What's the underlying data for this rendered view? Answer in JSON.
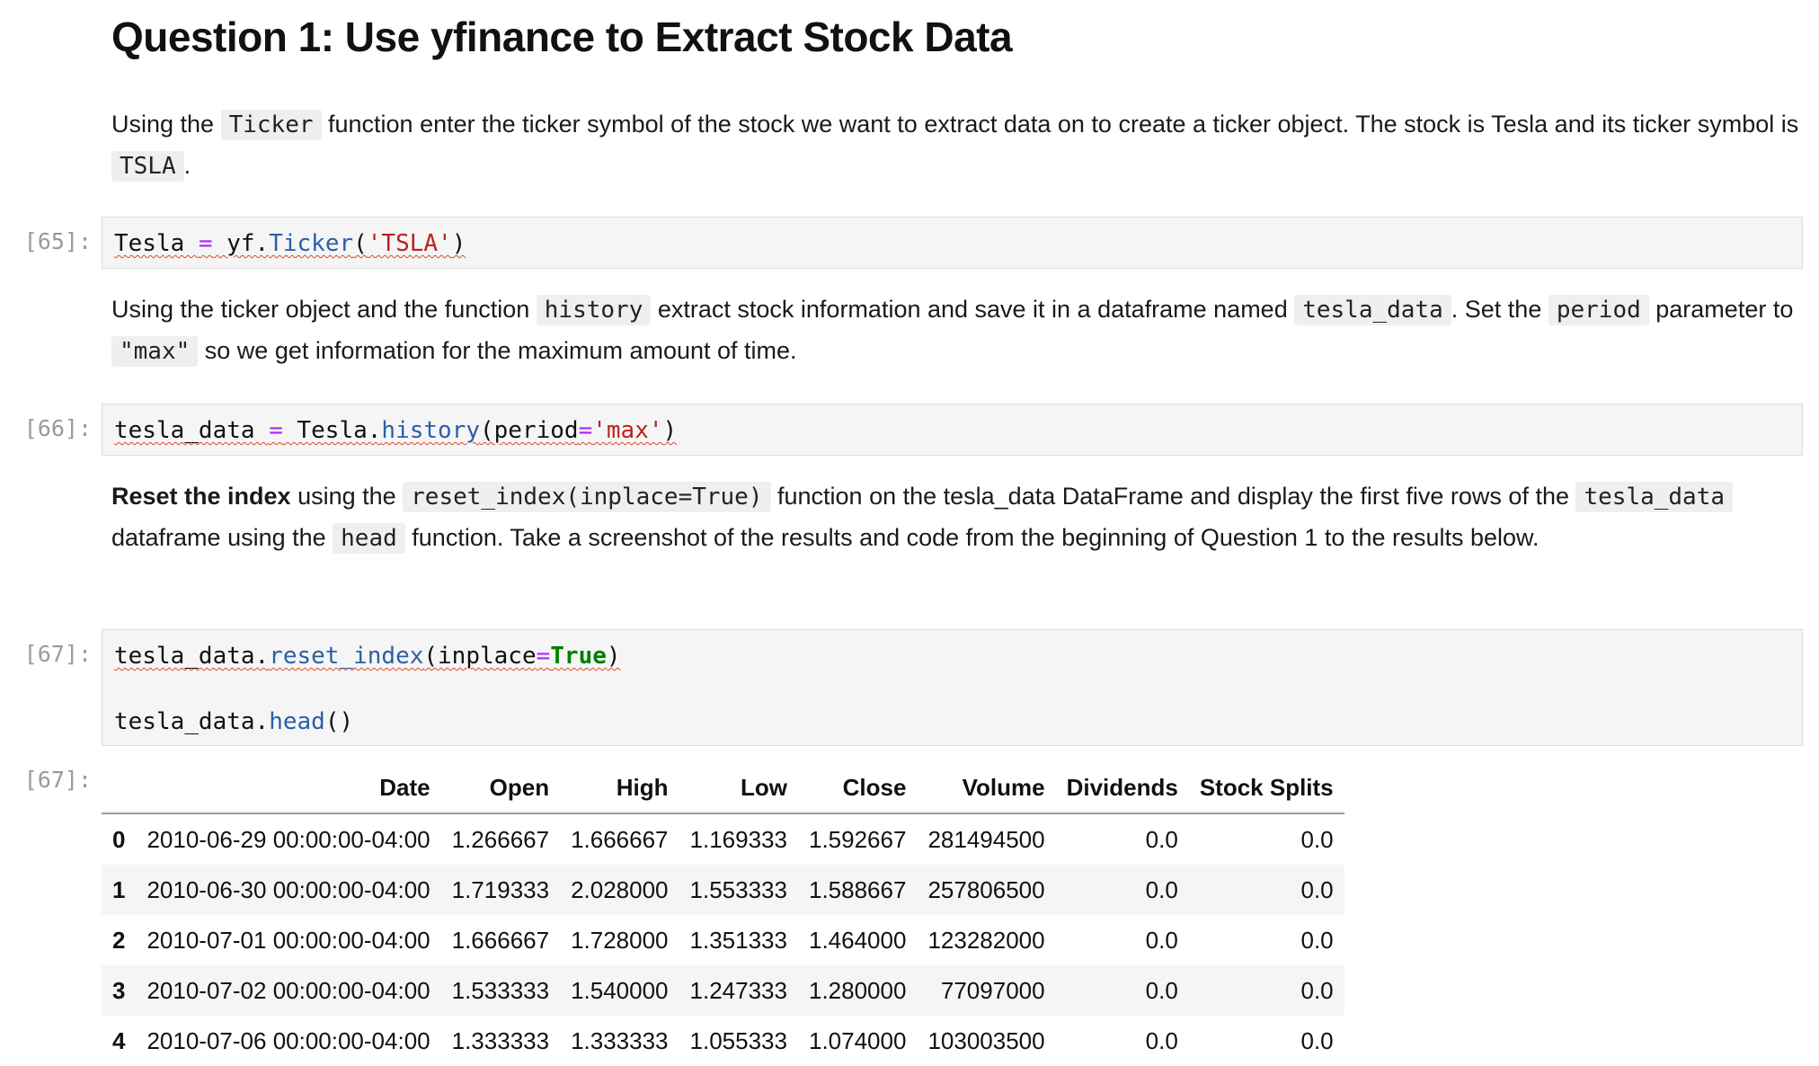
{
  "heading": "Question 1: Use yfinance to Extract Stock Data",
  "para1": {
    "t1": "Using the ",
    "c1": "Ticker",
    "t2": " function enter the ticker symbol of the stock we want to extract data on to create a ticker object. The stock is Tesla and its ticker symbol is ",
    "c2": "TSLA",
    "t3": "."
  },
  "cell65": {
    "prompt": "[65]:",
    "p1": "Tesla ",
    "p2": "=",
    "p3": " yf.",
    "p4": "Ticker",
    "p5": "(",
    "p6": "'TSLA'",
    "p7": ")"
  },
  "para2": {
    "t1": "Using the ticker object and the function ",
    "c1": "history",
    "t2": " extract stock information and save it in a dataframe named ",
    "c2": "tesla_data",
    "t3": ". Set the ",
    "c3": "period",
    "t4": " parameter to ",
    "c4": "\"max\"",
    "t5": " so we get information for the maximum amount of time."
  },
  "cell66": {
    "prompt": "[66]:",
    "p1": "tesla_data ",
    "p2": "=",
    "p3": " Tesla.",
    "p4": "history",
    "p5": "(period",
    "p6": "=",
    "p7": "'max'",
    "p8": ")"
  },
  "para3": {
    "b1": "Reset the index",
    "t1": " using the ",
    "c1": "reset_index(inplace=True)",
    "t2": " function on the tesla_data DataFrame and display the first five rows of the ",
    "c2": "tesla_data",
    "t3": " dataframe using the ",
    "c3": "head",
    "t4": " function. Take a screenshot of the results and code from the beginning of Question 1 to the results below."
  },
  "cell67": {
    "prompt": "[67]:",
    "l1p1": "tesla_data.",
    "l1p2": "reset_index",
    "l1p3": "(inplace",
    "l1p4": "=",
    "l1p5": "True",
    "l1p6": ")",
    "l2p1": "tesla_data.",
    "l2p2": "head",
    "l2p3": "()"
  },
  "output67": {
    "prompt": "[67]:",
    "columns": [
      "",
      "Date",
      "Open",
      "High",
      "Low",
      "Close",
      "Volume",
      "Dividends",
      "Stock Splits"
    ],
    "rows": [
      [
        "0",
        "2010-06-29 00:00:00-04:00",
        "1.266667",
        "1.666667",
        "1.169333",
        "1.592667",
        "281494500",
        "0.0",
        "0.0"
      ],
      [
        "1",
        "2010-06-30 00:00:00-04:00",
        "1.719333",
        "2.028000",
        "1.553333",
        "1.588667",
        "257806500",
        "0.0",
        "0.0"
      ],
      [
        "2",
        "2010-07-01 00:00:00-04:00",
        "1.666667",
        "1.728000",
        "1.351333",
        "1.464000",
        "123282000",
        "0.0",
        "0.0"
      ],
      [
        "3",
        "2010-07-02 00:00:00-04:00",
        "1.533333",
        "1.540000",
        "1.247333",
        "1.280000",
        "77097000",
        "0.0",
        "0.0"
      ],
      [
        "4",
        "2010-07-06 00:00:00-04:00",
        "1.333333",
        "1.333333",
        "1.055333",
        "1.074000",
        "103003500",
        "0.0",
        "0.0"
      ]
    ]
  }
}
